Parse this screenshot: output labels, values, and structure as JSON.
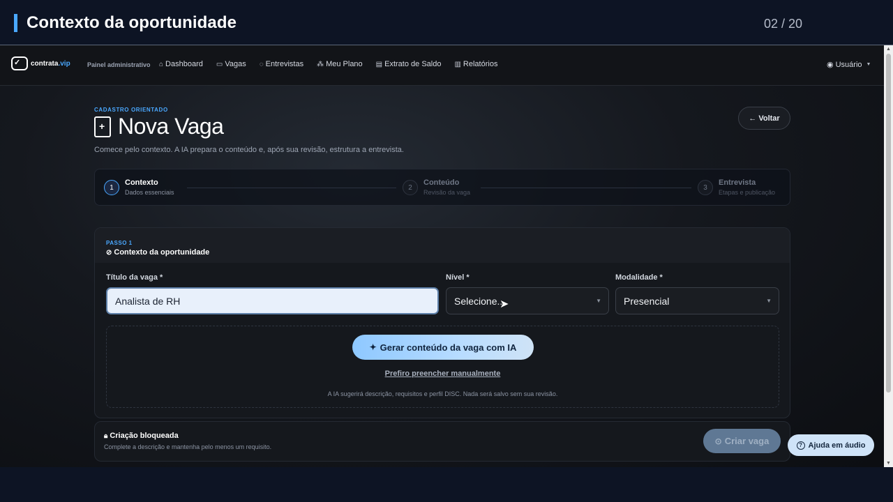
{
  "slide": {
    "title": "Contexto da oportunidade",
    "counter": "02 / 20"
  },
  "nav": {
    "logo_main": "contrata",
    "logo_suffix": ".vip",
    "subtitle": "Painel administrativo",
    "items": [
      {
        "label": "Dashboard",
        "icon": "home-icon"
      },
      {
        "label": "Vagas",
        "icon": "briefcase-icon"
      },
      {
        "label": "Entrevistas",
        "icon": "chat-icon"
      },
      {
        "label": "Meu Plano",
        "icon": "hierarchy-icon"
      },
      {
        "label": "Extrato de Saldo",
        "icon": "receipt-icon"
      },
      {
        "label": "Relatórios",
        "icon": "bar-chart-icon"
      }
    ],
    "user": "Usuário"
  },
  "page": {
    "eyebrow": "CADASTRO ORIENTADO",
    "title": "Nova Vaga",
    "description": "Comece pelo contexto. A IA prepara o conteúdo e, após sua revisão, estrutura a entrevista.",
    "back_label": "← Voltar"
  },
  "stepper": [
    {
      "number": "1",
      "title": "Contexto",
      "subtitle": "Dados essenciais",
      "active": true
    },
    {
      "number": "2",
      "title": "Conteúdo",
      "subtitle": "Revisão da vaga",
      "active": false
    },
    {
      "number": "3",
      "title": "Entrevista",
      "subtitle": "Etapas e publicação",
      "active": false
    }
  ],
  "form": {
    "step_label": "PASSO 1",
    "section_title": "Contexto da oportunidade",
    "job_title_label": "Título da vaga *",
    "job_title_value": "Analista de RH",
    "level_label": "Nível *",
    "level_value": "Selecione...",
    "mode_label": "Modalidade *",
    "mode_value": "Presencial",
    "ai_button": "Gerar conteúdo da vaga com IA",
    "manual_link": "Prefiro preencher manualmente",
    "ai_note": "A IA sugerirá descrição, requisitos e perfil DISC. Nada será salvo sem sua revisão."
  },
  "lock": {
    "title": "Criação bloqueada",
    "description": "Complete a descrição e mantenha pelo menos um requisito.",
    "create_button": "Criar vaga"
  },
  "help_button": "Ajuda em áudio"
}
